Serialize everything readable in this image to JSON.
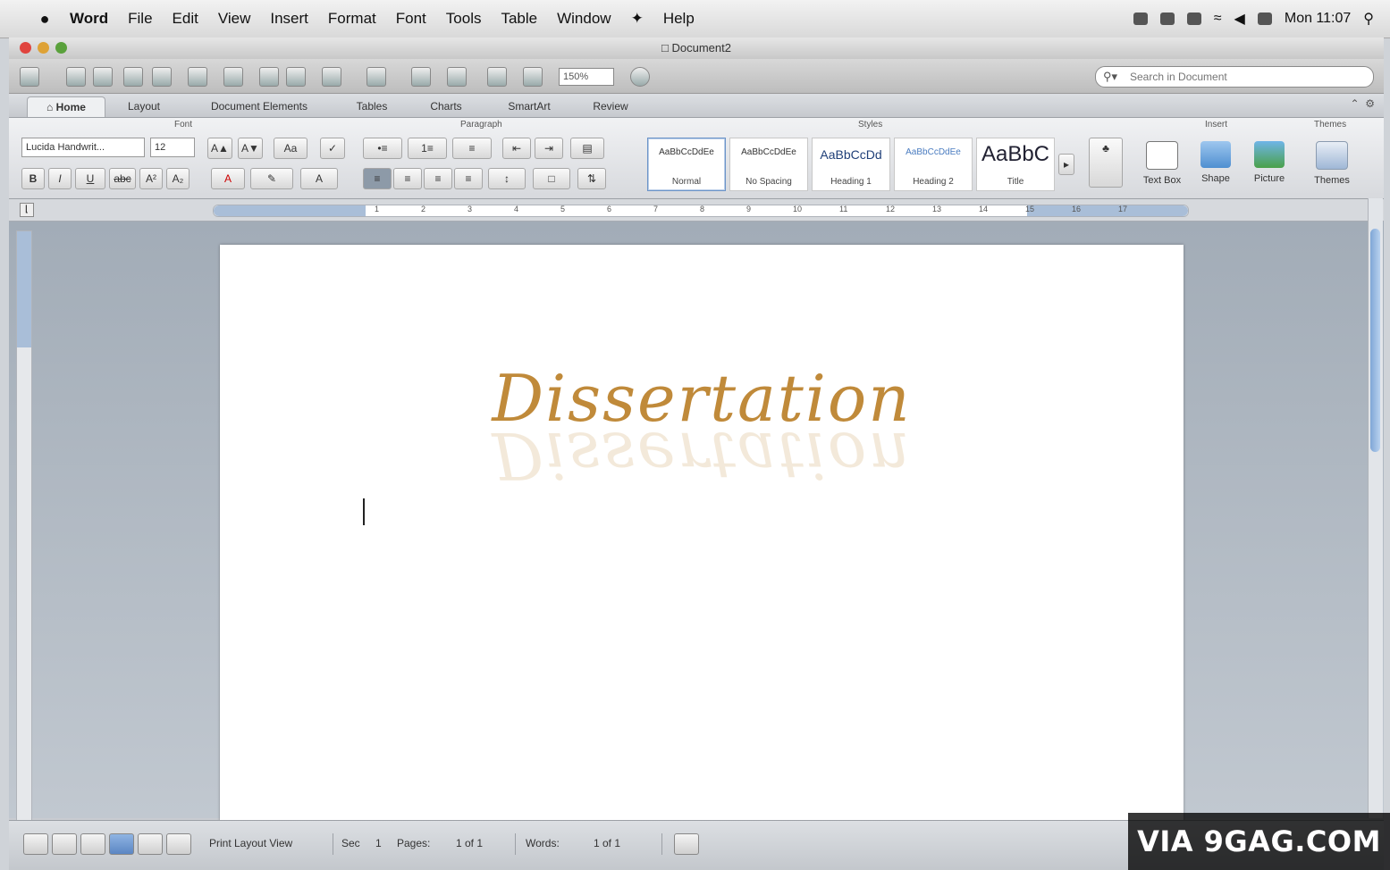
{
  "menubar": {
    "app_name": "Word",
    "items": [
      "File",
      "Edit",
      "View",
      "Insert",
      "Format",
      "Font",
      "Tools",
      "Table",
      "Window",
      "Help"
    ],
    "clock": "Mon 11:07"
  },
  "window": {
    "title": "Document2",
    "zoom": "150%",
    "search_placeholder": "Search in Document"
  },
  "ribbon": {
    "tabs": [
      "Home",
      "Layout",
      "Document Elements",
      "Tables",
      "Charts",
      "SmartArt",
      "Review"
    ],
    "groups": {
      "font": "Font",
      "paragraph": "Paragraph",
      "styles": "Styles",
      "insert": "Insert",
      "themes": "Themes"
    },
    "font_name": "Lucida Handwrit...",
    "font_size": "12",
    "styles": [
      {
        "sample": "AaBbCcDdEe",
        "name": "Normal"
      },
      {
        "sample": "AaBbCcDdEe",
        "name": "No Spacing"
      },
      {
        "sample": "AaBbCcDd",
        "name": "Heading 1"
      },
      {
        "sample": "AaBbCcDdEe",
        "name": "Heading 2"
      },
      {
        "sample": "AaBbC",
        "name": "Title"
      }
    ],
    "insert_buttons": [
      "Text Box",
      "Shape",
      "Picture"
    ],
    "themes_button": "Themes"
  },
  "ruler": {
    "numbers": [
      "1",
      "2",
      "3",
      "4",
      "5",
      "6",
      "7",
      "8",
      "9",
      "10",
      "11",
      "12",
      "13",
      "14",
      "15",
      "16",
      "17"
    ]
  },
  "document": {
    "title": "Dissertation"
  },
  "statusbar": {
    "view": "Print Layout View",
    "sec_label": "Sec",
    "sec_value": "1",
    "pages_label": "Pages:",
    "pages_value": "1 of 1",
    "words_label": "Words:",
    "words_value": "1 of 1"
  },
  "watermark": "VIA 9GAG.COM",
  "colors": {
    "title": "#c08a3a",
    "ruler_margin": "#a9bed8",
    "scroll_thumb": "#7fa6d6"
  }
}
